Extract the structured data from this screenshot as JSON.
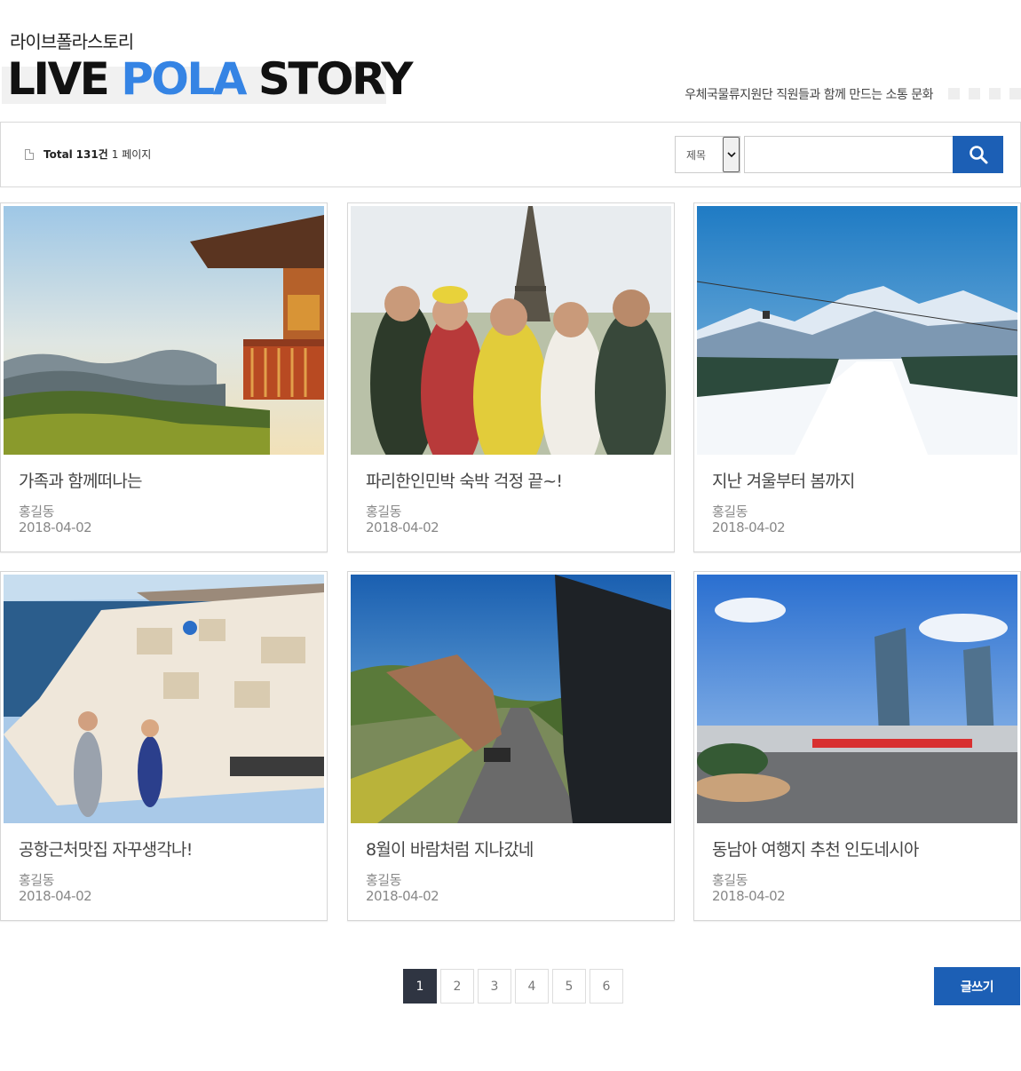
{
  "header": {
    "subtitle": "라이브폴라스토리",
    "title_part1": "LIVE",
    "title_part2": "POLA",
    "title_part3": "STORY",
    "tagline": "우체국물류지원단 직원들과 함께 만드는 소통 문화"
  },
  "toolbar": {
    "total_label": "Total",
    "total_count": "131건",
    "page_info": "1 페이지",
    "search_field_selected": "제목",
    "search_value": ""
  },
  "posts": [
    {
      "title": "가족과 함께떠나는",
      "author": "홍길동",
      "date": "2018-04-02",
      "image": "temple-mountain-sunset"
    },
    {
      "title": "파리한인민박 숙박 걱정 끝~!",
      "author": "홍길동",
      "date": "2018-04-02",
      "image": "eiffel-tower-group"
    },
    {
      "title": "지난 겨울부터 봄까지",
      "author": "홍길동",
      "date": "2018-04-02",
      "image": "snowy-mountains-ski"
    },
    {
      "title": "공항근처맛집 자꾸생각나!",
      "author": "홍길동",
      "date": "2018-04-02",
      "image": "santorini-couple"
    },
    {
      "title": "8월이 바람처럼 지나갔네",
      "author": "홍길동",
      "date": "2018-04-02",
      "image": "road-car-window"
    },
    {
      "title": "동남아 여행지 추천 인도네시아",
      "author": "홍길동",
      "date": "2018-04-02",
      "image": "city-towers"
    }
  ],
  "pagination": {
    "pages": [
      "1",
      "2",
      "3",
      "4",
      "5",
      "6"
    ],
    "current": "1"
  },
  "write_button": "글쓰기",
  "colors": {
    "accent": "#1c5fb5",
    "title_highlight": "#3584e4",
    "active_page": "#2f3542"
  }
}
